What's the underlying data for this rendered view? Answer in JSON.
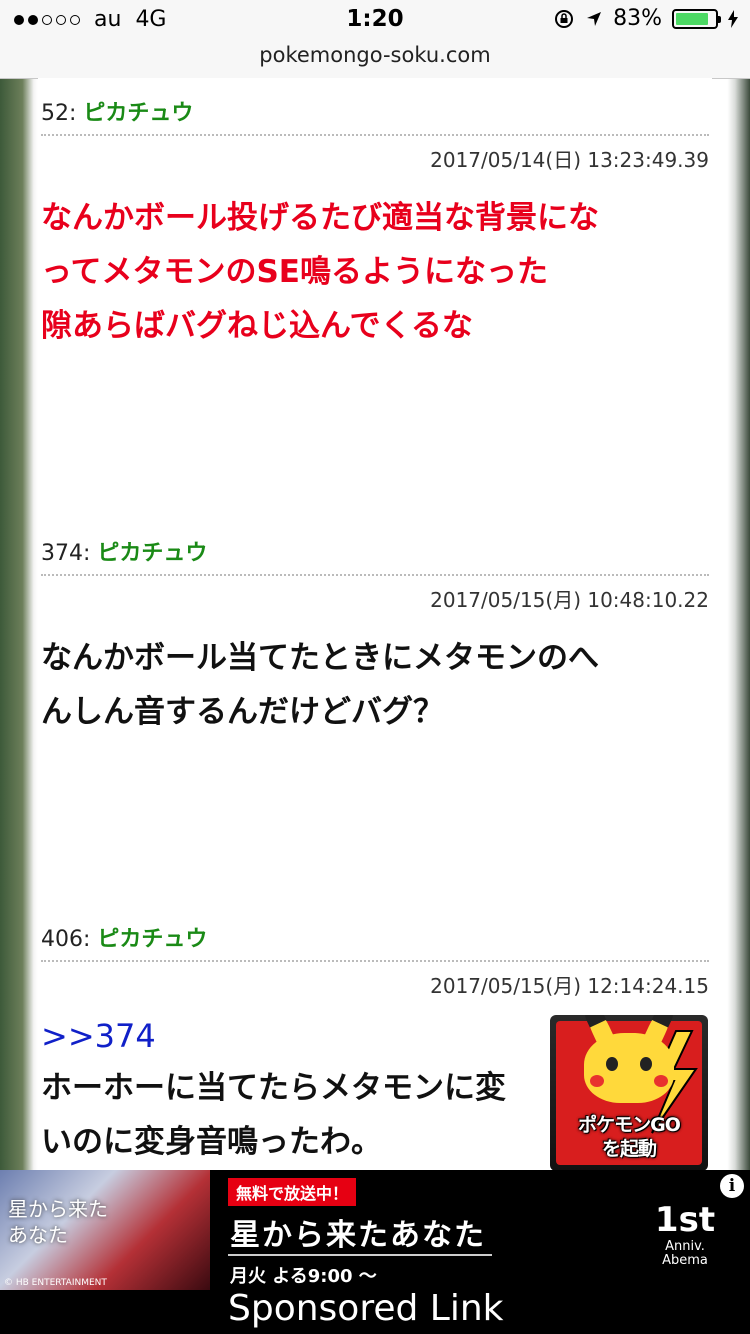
{
  "status_bar": {
    "signal_dots_filled": 2,
    "signal_dots_total": 5,
    "carrier": "au",
    "network": "4G",
    "time": "1:20",
    "battery_percent": "83%",
    "battery_level": 0.83
  },
  "browser": {
    "url": "pokemongo-soku.com"
  },
  "posts": [
    {
      "number": "52:",
      "name": "ピカチュウ",
      "date": "2017/05/14(日) 13:23:49.39",
      "color": "#e8001c",
      "lines": [
        "なんかボール投げるたび適当な背景にな",
        "ってメタモンのSE鳴るようになった",
        "隙あらばバグねじ込んでくるな"
      ]
    },
    {
      "number": "374:",
      "name": "ピカチュウ",
      "date": "2017/05/15(月) 10:48:10.22",
      "color": "#111111",
      "lines": [
        "なんかボール当てたときにメタモンのへ",
        "んしん音するんだけどバグ？"
      ]
    },
    {
      "number": "406:",
      "name": "ピカチュウ",
      "date": "2017/05/15(月) 12:14:24.15",
      "color": "#111111",
      "anchor": ">>374",
      "lines": [
        "ホーホーに当てたらメタモンに変",
        "いのに変身音鳴ったわ。"
      ]
    }
  ],
  "floating_button": {
    "label_line1": "ポケモンGO",
    "label_line2": "を起動"
  },
  "ad": {
    "image_logo_line1": "星から来た",
    "image_logo_line2": "あなた",
    "image_credit": "© HB ENTERTAINMENT",
    "badge": "無料で放送中！",
    "title": "星から来たあなた",
    "schedule": "月火 よる9:00 ～",
    "anniv_big": "1st",
    "anniv_small": "Anniv.",
    "anniv_brand": "Abema",
    "info_icon": "i",
    "sponsored": "Sponsored Link"
  }
}
